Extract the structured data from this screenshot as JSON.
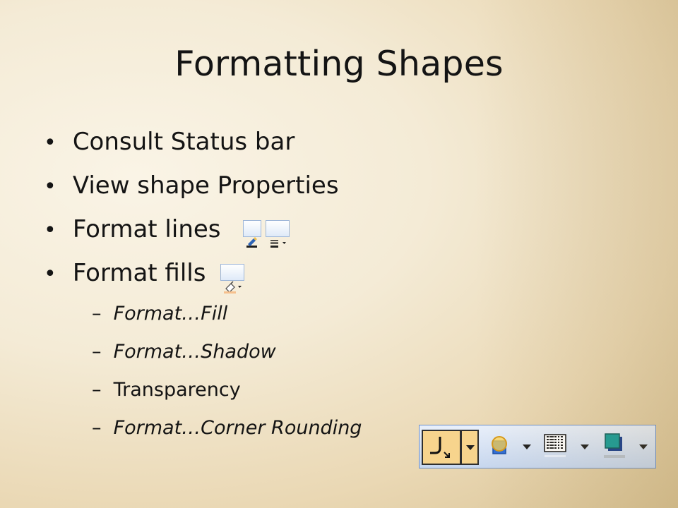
{
  "slide": {
    "title": "Formatting Shapes",
    "bullets": [
      {
        "label": "Consult Status bar"
      },
      {
        "label": "View shape Properties"
      },
      {
        "label": "Format lines",
        "icons": [
          "line-color-icon",
          "line-style-icon"
        ]
      },
      {
        "label": "Format fills",
        "icons": [
          "fill-color-icon"
        ]
      }
    ],
    "subitems": [
      {
        "label": "Format…Fill",
        "italic": true
      },
      {
        "label": "Format…Shadow",
        "italic": true
      },
      {
        "label": "Transparency",
        "italic": false
      },
      {
        "label": "Format…Corner Rounding",
        "italic": true
      }
    ],
    "bullet_symbol": "•",
    "dash_symbol": "–"
  },
  "toolbar": {
    "buttons": [
      {
        "name": "corner-rounding-icon",
        "active": true
      },
      {
        "name": "fill-style-icon",
        "active": false
      },
      {
        "name": "pattern-fill-icon",
        "active": false
      },
      {
        "name": "shadow-color-icon",
        "active": false
      }
    ]
  },
  "colors": {
    "background_light": "#faf4e6",
    "background_dark": "#d8c294",
    "text": "#141414",
    "toolbar_bg": "#dfe9f8",
    "toolbar_border": "#6c8fc8",
    "active_button": "#f7d48d"
  }
}
